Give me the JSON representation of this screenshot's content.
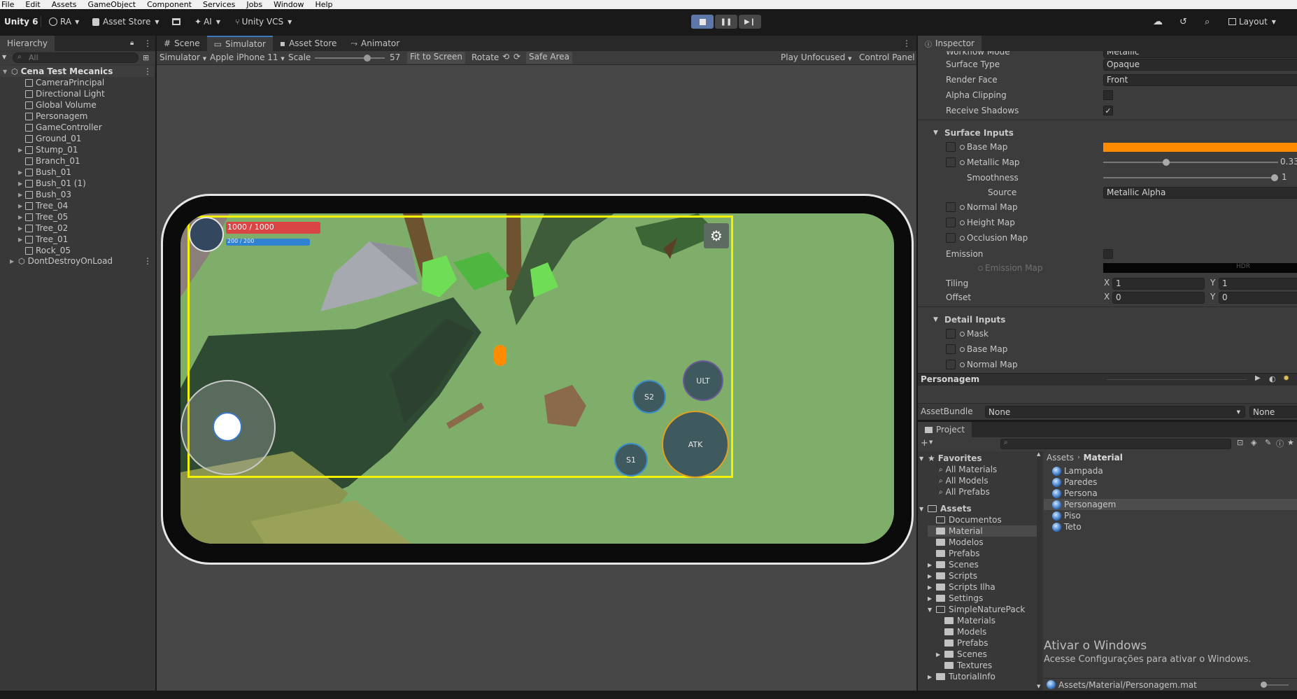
{
  "menu": [
    "File",
    "Edit",
    "Assets",
    "GameObject",
    "Component",
    "Services",
    "Jobs",
    "Window",
    "Help"
  ],
  "toolbar": {
    "unity_label": "Unity 6",
    "account": "RA",
    "asset_store": "Asset Store",
    "ai": "AI",
    "vcs": "Unity VCS",
    "layout": "Layout"
  },
  "hierarchy": {
    "tab": "Hierarchy",
    "search_placeholder": "All",
    "scene_name": "Cena Test Mecanics",
    "items": [
      "CameraPrincipal",
      "Directional Light",
      "Global Volume",
      "Personagem",
      "GameController",
      "Ground_01",
      "Stump_01",
      "Branch_01",
      "Bush_01",
      "Bush_01 (1)",
      "Bush_03",
      "Tree_04",
      "Tree_05",
      "Tree_02",
      "Tree_01",
      "Rock_05"
    ],
    "dont_destroy": "DontDestroyOnLoad"
  },
  "scene_tabs": {
    "scene": "Scene",
    "simulator": "Simulator",
    "asset_store": "Asset Store",
    "animator": "Animator"
  },
  "simulator_toolbar": {
    "mode": "Simulator",
    "device": "Apple iPhone 11",
    "scale_label": "Scale",
    "scale_value": "57",
    "fit": "Fit to Screen",
    "rotate": "Rotate",
    "safe_area": "Safe Area",
    "play_unfocused": "Play Unfocused",
    "control_panel": "Control Panel"
  },
  "game_ui": {
    "hp_text": "1000 / 1000",
    "mp_text": "200 / 200",
    "hp_fraction": 1.0,
    "mp_fraction": 1.0,
    "btn_ult": "ULT",
    "btn_s2": "S2",
    "btn_s1": "S1",
    "btn_atk": "ATK"
  },
  "inspector": {
    "tab": "Inspector",
    "workflow_mode": "Workflow Mode",
    "workflow_value": "Metallic",
    "surface_type": "Surface Type",
    "surface_type_value": "Opaque",
    "render_face": "Render Face",
    "render_face_value": "Front",
    "alpha_clipping": "Alpha Clipping",
    "receive_shadows": "Receive Shadows",
    "surface_inputs": "Surface Inputs",
    "base_map": "Base Map",
    "metallic_map": "Metallic Map",
    "metallic_value": "0.33",
    "smoothness": "Smoothness",
    "smoothness_value": "1",
    "source": "Source",
    "source_value": "Metallic Alpha",
    "normal_map": "Normal Map",
    "height_map": "Height Map",
    "occlusion_map": "Occlusion Map",
    "emission": "Emission",
    "emission_map": "Emission Map",
    "hdr": "HDR",
    "tiling": "Tiling",
    "offset": "Offset",
    "x": "X",
    "y": "Y",
    "tiling_x": "1",
    "tiling_y": "1",
    "offset_x": "0",
    "offset_y": "0",
    "detail_inputs": "Detail Inputs",
    "mask": "Mask",
    "detail_base_map": "Base Map",
    "detail_normal_map": "Normal Map",
    "preview_name": "Personagem",
    "asset_bundle": "AssetBundle",
    "asset_bundle_value": "None",
    "asset_variant_value": "None",
    "base_color": "#ff8c00"
  },
  "project": {
    "tab": "Project",
    "favorites": "Favorites",
    "fav_items": [
      "All Materials",
      "All Models",
      "All Prefabs"
    ],
    "assets": "Assets",
    "folders": [
      "Documentos",
      "Material",
      "Modelos",
      "Prefabs",
      "Scenes",
      "Scripts",
      "Scripts Ilha",
      "Settings",
      "SimpleNaturePack"
    ],
    "snp_folders": [
      "Materials",
      "Models",
      "Prefabs",
      "Scenes",
      "Textures"
    ],
    "tutorial": "TutorialInfo",
    "breadcrumb_root": "Assets",
    "breadcrumb_current": "Material",
    "files": [
      "Lampada",
      "Paredes",
      "Persona",
      "Personagem",
      "Piso",
      "Teto"
    ],
    "selected_path": "Assets/Material/Personagem.mat",
    "watermark_title": "Ativar o Windows",
    "watermark_sub": "Acesse Configurações para ativar o Windows."
  }
}
